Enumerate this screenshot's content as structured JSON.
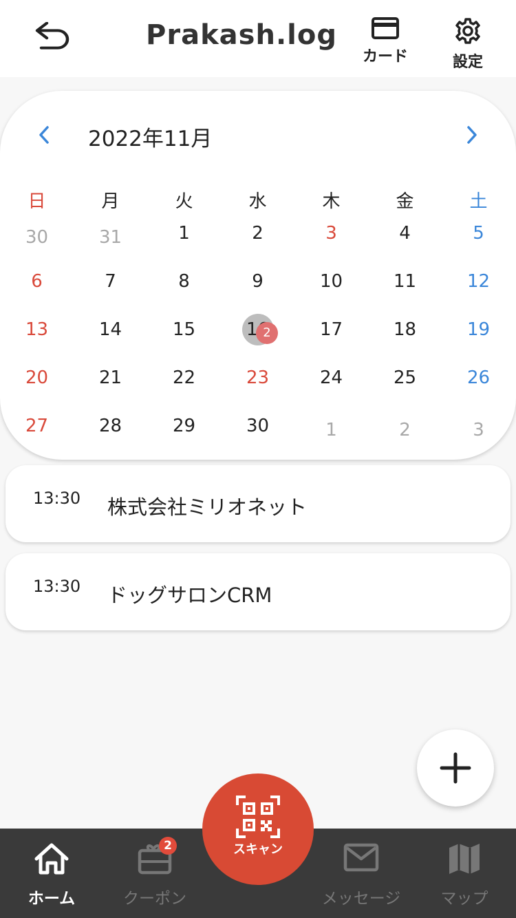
{
  "header": {
    "title": "Prakash.log",
    "card_label": "カード",
    "settings_label": "設定"
  },
  "calendar": {
    "month_label": "2022年11月",
    "weekdays": [
      "日",
      "月",
      "火",
      "水",
      "木",
      "金",
      "土"
    ],
    "weeks": [
      [
        "30",
        "31",
        "1",
        "2",
        "3",
        "4",
        "5"
      ],
      [
        "6",
        "7",
        "8",
        "9",
        "10",
        "11",
        "12"
      ],
      [
        "13",
        "14",
        "15",
        "16",
        "17",
        "18",
        "19"
      ],
      [
        "20",
        "21",
        "22",
        "23",
        "24",
        "25",
        "26"
      ],
      [
        "27",
        "28",
        "29",
        "30",
        "1",
        "2",
        "3"
      ]
    ],
    "selected_day": "16",
    "selected_event_count": "2"
  },
  "events": [
    {
      "time": "13:30",
      "title": "株式会社ミリオネット"
    },
    {
      "time": "13:30",
      "title": "ドッグサロンCRM"
    }
  ],
  "bottom_nav": {
    "home_label": "ホーム",
    "coupon_label": "クーポン",
    "coupon_badge": "2",
    "scan_label": "スキャン",
    "message_label": "メッセージ",
    "map_label": "マップ"
  },
  "colors": {
    "accent_red": "#d84a34",
    "sunday_red": "#d9493a",
    "saturday_blue": "#3a86d9",
    "nav_bg": "#3a3a3a"
  }
}
